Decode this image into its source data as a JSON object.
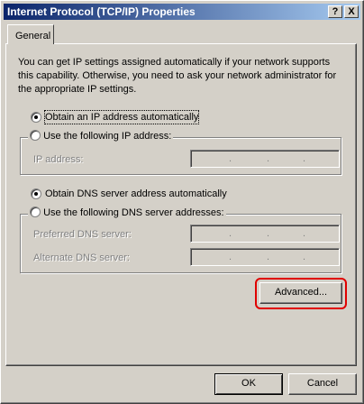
{
  "window": {
    "title": "Internet Protocol (TCP/IP) Properties",
    "help_btn": "?",
    "close_btn": "X"
  },
  "tabs": [
    {
      "label": "General",
      "selected": true
    }
  ],
  "intro_text": "You can get IP settings assigned automatically if your network supports this capability. Otherwise, you need to ask your network administrator for the appropriate IP settings.",
  "ip": {
    "auto_label": "Obtain an IP address automatically",
    "manual_label": "Use the following IP address:",
    "selected": "auto",
    "address_label": "IP address:",
    "address_value": ". . ."
  },
  "dns": {
    "auto_label": "Obtain DNS server address automatically",
    "manual_label": "Use the following DNS server addresses:",
    "selected": "auto",
    "preferred_label": "Preferred DNS server:",
    "alternate_label": "Alternate DNS server:"
  },
  "buttons": {
    "advanced": "Advanced...",
    "ok": "OK",
    "cancel": "Cancel"
  },
  "highlight_color": "#e00000"
}
